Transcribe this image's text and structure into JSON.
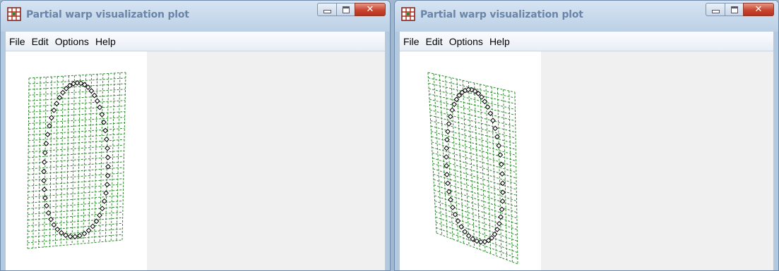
{
  "windows": [
    {
      "title": "Partial warp visualization plot",
      "menu": [
        "File",
        "Edit",
        "Options",
        "Help"
      ],
      "controls": {
        "minimize_icon": "minimize-icon",
        "maximize_icon": "maximize-icon",
        "close_icon": "close-icon",
        "close_glyph": "✕"
      },
      "plot": {
        "description_icon": "warp-grid",
        "grid_color": "#2e8b2e",
        "landmark_color": "#000000"
      }
    },
    {
      "title": "Partial warp visualization plot",
      "menu": [
        "File",
        "Edit",
        "Options",
        "Help"
      ],
      "controls": {
        "minimize_icon": "minimize-icon",
        "maximize_icon": "maximize-icon",
        "close_icon": "close-icon",
        "close_glyph": "✕"
      },
      "plot": {
        "description_icon": "warp-grid",
        "grid_color": "#2e8b2e",
        "landmark_color": "#000000"
      }
    }
  ]
}
